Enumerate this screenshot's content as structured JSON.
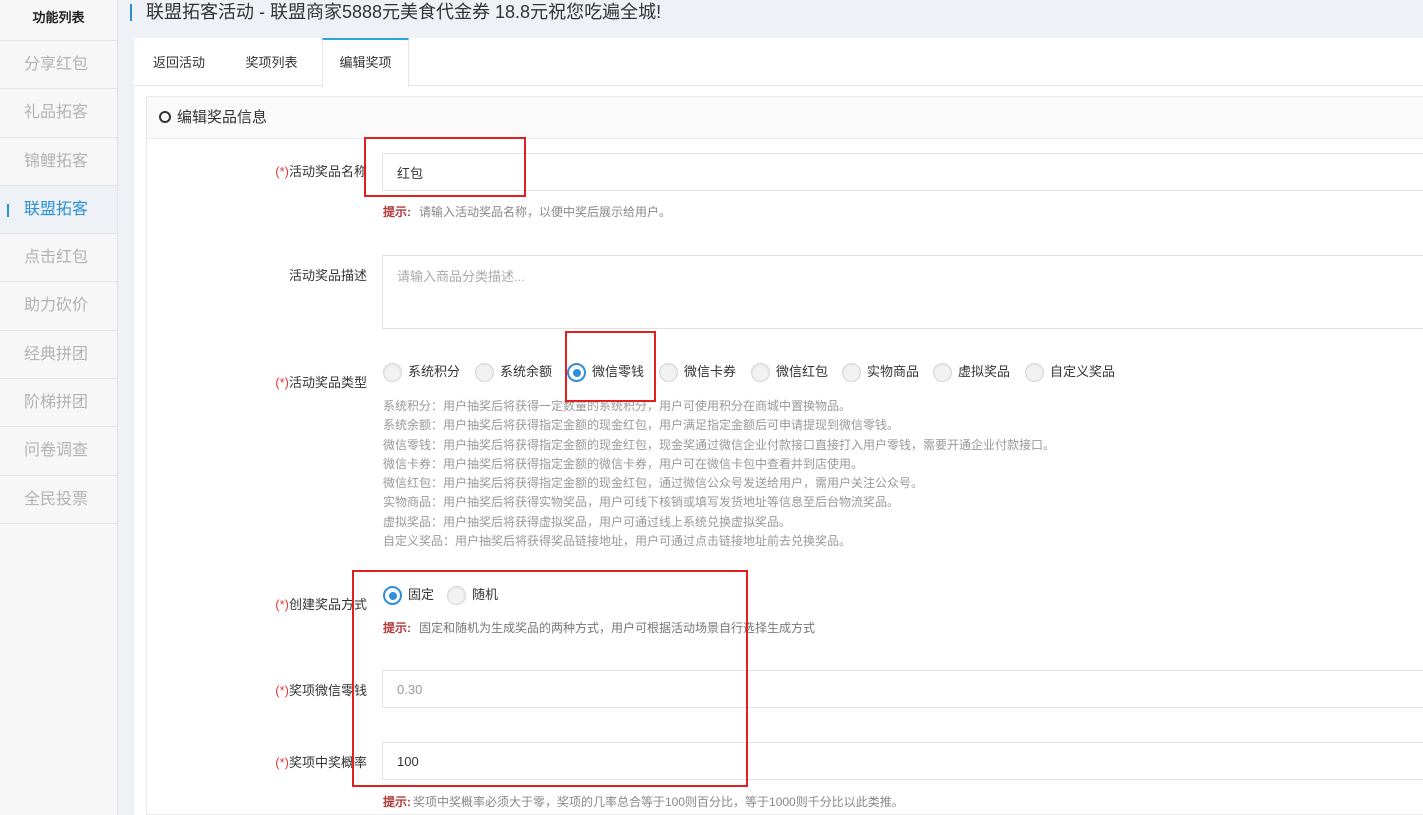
{
  "sidebar": {
    "title": "功能列表",
    "items": [
      {
        "label": "分享红包"
      },
      {
        "label": "礼品拓客"
      },
      {
        "label": "锦鲤拓客"
      },
      {
        "label": "联盟拓客"
      },
      {
        "label": "点击红包"
      },
      {
        "label": "助力砍价"
      },
      {
        "label": "经典拼团"
      },
      {
        "label": "阶梯拼团"
      },
      {
        "label": "问卷调查"
      },
      {
        "label": "全民投票"
      }
    ],
    "active_item": "联盟拓客"
  },
  "header": {
    "title": "联盟拓客活动 - 联盟商家5888元美食代金券 18.8元祝您吃遍全城!"
  },
  "tabs": [
    {
      "label": "返回活动"
    },
    {
      "label": "奖项列表"
    },
    {
      "label": "编辑奖项"
    }
  ],
  "active_tab": "编辑奖项",
  "section": {
    "title": "编辑奖品信息"
  },
  "form": {
    "required_mark": "(*)",
    "name": {
      "label": "活动奖品名称",
      "value": "红包",
      "hint_label": "提示:",
      "hint": "请输入活动奖品名称，以便中奖后展示给用户。"
    },
    "desc": {
      "label": "活动奖品描述",
      "placeholder": "请输入商品分类描述..."
    },
    "type": {
      "label": "活动奖品类型",
      "options": [
        {
          "label": "系统积分"
        },
        {
          "label": "系统余额"
        },
        {
          "label": "微信零钱"
        },
        {
          "label": "微信卡券"
        },
        {
          "label": "微信红包"
        },
        {
          "label": "实物商品"
        },
        {
          "label": "虚拟奖品"
        },
        {
          "label": "自定义奖品"
        }
      ],
      "selected": "微信零钱",
      "descriptions": [
        "系统积分：用户抽奖后将获得一定数量的系统积分，用户可使用积分在商城中置换物品。",
        "系统余额：用户抽奖后将获得指定金额的现金红包，用户满足指定金额后可申请提现到微信零钱。",
        "微信零钱：用户抽奖后将获得指定金额的现金红包，现金奖通过微信企业付款接口直接打入用户零钱，需要开通企业付款接口。",
        "微信卡券：用户抽奖后将获得指定金额的微信卡券，用户可在微信卡包中查看并到店使用。",
        "微信红包：用户抽奖后将获得指定金额的现金红包，通过微信公众号发送给用户，需用户关注公众号。",
        "实物商品：用户抽奖后将获得实物奖品，用户可线下核销或填写发货地址等信息至后台物流奖品。",
        "虚拟奖品：用户抽奖后将获得虚拟奖品，用户可通过线上系统兑换虚拟奖品。",
        "自定义奖品：用户抽奖后将获得奖品链接地址，用户可通过点击链接地址前去兑换奖品。"
      ]
    },
    "method": {
      "label": "创建奖品方式",
      "options": [
        {
          "label": "固定"
        },
        {
          "label": "随机"
        }
      ],
      "selected": "固定",
      "hint_label": "提示:",
      "hint": "固定和随机为生成奖品的两种方式，用户可根据活动场景自行选择生成方式"
    },
    "amount": {
      "label": "奖项微信零钱",
      "value": "0.30"
    },
    "probability": {
      "label": "奖项中奖概率",
      "value": "100",
      "hint_label": "提示:",
      "hint": "奖项中奖概率必须大于零，奖项的几率总合等于100则百分比，等于1000则千分比以此类推。"
    }
  },
  "colors": {
    "accent": "#2b8fd6",
    "required": "#e4393c",
    "annotation_box": "#e02020"
  }
}
